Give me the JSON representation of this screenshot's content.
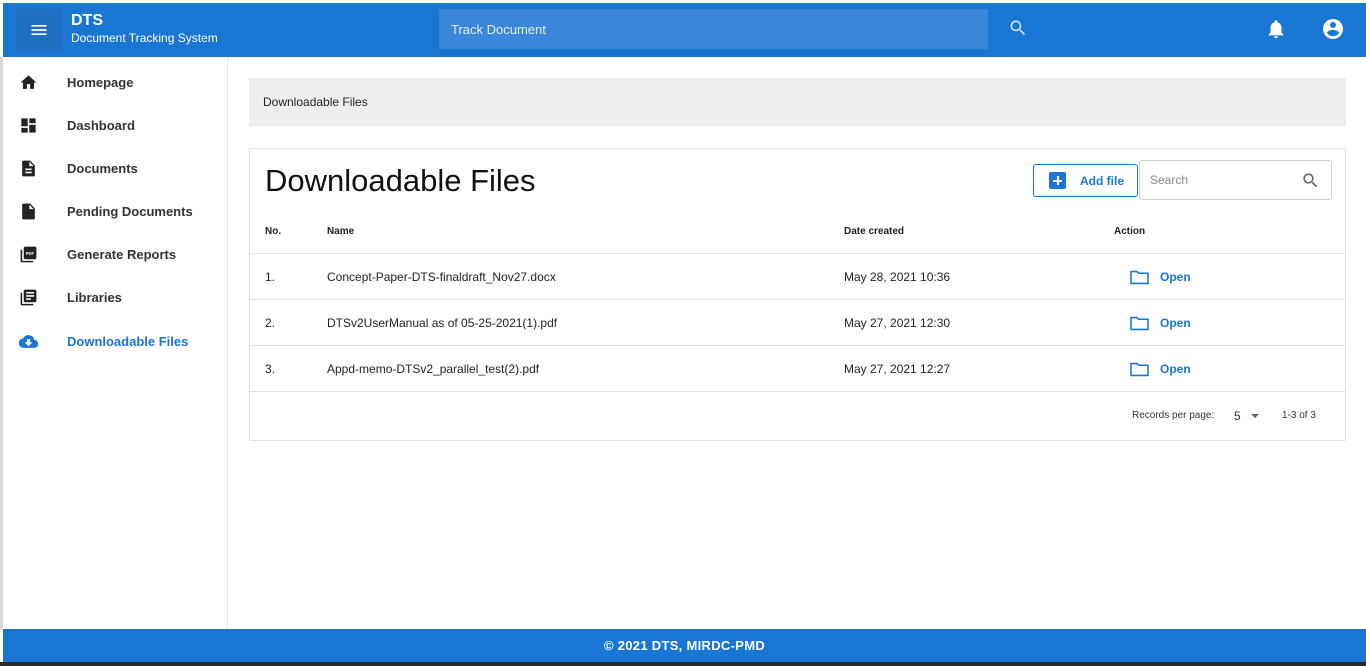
{
  "header": {
    "app_title": "DTS",
    "app_subtitle": "Document Tracking System",
    "track_placeholder": "Track Document"
  },
  "sidebar": {
    "items": [
      {
        "label": "Homepage",
        "icon": "home-icon"
      },
      {
        "label": "Dashboard",
        "icon": "dashboard-icon"
      },
      {
        "label": "Documents",
        "icon": "document-icon"
      },
      {
        "label": "Pending Documents",
        "icon": "file-icon"
      },
      {
        "label": "Generate Reports",
        "icon": "pdf-icon"
      },
      {
        "label": "Libraries",
        "icon": "library-icon"
      },
      {
        "label": "Downloadable Files",
        "icon": "cloud-download-icon",
        "active": true
      }
    ]
  },
  "breadcrumb": {
    "current": "Downloadable Files"
  },
  "card": {
    "title": "Downloadable Files",
    "add_file_label": "Add file",
    "search_placeholder": "Search",
    "columns": {
      "no": "No.",
      "name": "Name",
      "date": "Date created",
      "action": "Action"
    },
    "rows": [
      {
        "no": "1.",
        "name": "Concept-Paper-DTS-finaldraft_Nov27.docx",
        "date": "May 28, 2021 10:36",
        "action": "Open"
      },
      {
        "no": "2.",
        "name": "DTSv2UserManual as of 05-25-2021(1).pdf",
        "date": "May 27, 2021 12:30",
        "action": "Open"
      },
      {
        "no": "3.",
        "name": "Appd-memo-DTSv2_parallel_test(2).pdf",
        "date": "May 27, 2021 12:27",
        "action": "Open"
      }
    ],
    "pagination": {
      "label": "Records per page:",
      "per_page": "5",
      "range": "1-3 of 3"
    }
  },
  "footer": {
    "text": "© 2021 DTS, MIRDC-PMD"
  },
  "colors": {
    "primary": "#1976d2",
    "breadcrumb_bg": "#eeeeee"
  }
}
